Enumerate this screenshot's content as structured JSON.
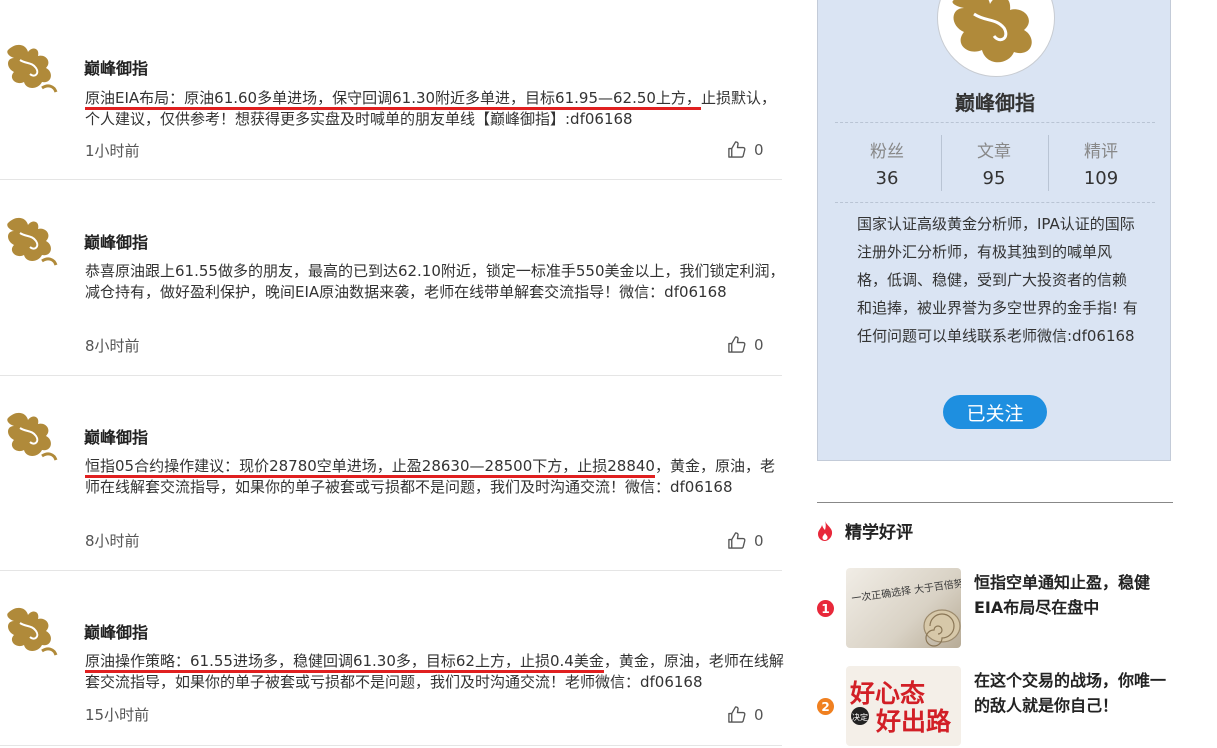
{
  "feed": {
    "posts": [
      {
        "author": "巅峰御指",
        "highlight": "原油EIA布局：原油61.60多单进场，保守回调61.30附近多单进，目标61.95—62.50上方，",
        "text": "止损默认，个人建议，仅供参考！想获得更多实盘及时喊单的朋友单线【巅峰御指】:df06168",
        "time": "1小时前",
        "likes": "0"
      },
      {
        "author": "巅峰御指",
        "highlight": "",
        "text": "恭喜原油跟上61.55做多的朋友，最高的已到达62.10附近，锁定一标准手550美金以上，我们锁定利润，减仓持有，做好盈利保护，晚间EIA原油数据来袭，老师在线带单解套交流指导！微信：df06168",
        "time": "8小时前",
        "likes": "0"
      },
      {
        "author": "巅峰御指",
        "highlight": "恒指05合约操作建议：现价28780空单进场，止盈28630—28500下方，止损28840",
        "text": "，黄金，原油，老师在线解套交流指导，如果你的单子被套或亏损都不是问题，我们及时沟通交流！微信：df06168",
        "time": "8小时前",
        "likes": "0"
      },
      {
        "author": "巅峰御指",
        "highlight": "原油操作策略：61.55进场多，稳健回调61.30多，目标62上方，止损0.4美金",
        "text": "，黄金，原油，老师在线解套交流指导，如果你的单子被套或亏损都不是问题，我们及时沟通交流！老师微信：df06168",
        "time": "15小时前",
        "likes": "0"
      }
    ]
  },
  "profile": {
    "name": "巅峰御指",
    "stats": [
      {
        "label": "粉丝",
        "value": "36"
      },
      {
        "label": "文章",
        "value": "95"
      },
      {
        "label": "精评",
        "value": "109"
      }
    ],
    "bio": "国家认证高级黄金分析师，IPA认证的国际注册外汇分析师，有极其独到的喊单风格，低调、稳健，受到广大投资者的信赖和追捧，被业界誉为多空世界的金手指! 有任何问题可以单线联系老师微信:df06168",
    "follow_label": "已关注"
  },
  "recommend": {
    "title": "精学好评",
    "items": [
      {
        "rank": "1",
        "title": "恒指空单通知止盈，稳健EIA布局尽在盘中",
        "thumb_text": "一次正确选择 大于百倍努力"
      },
      {
        "rank": "2",
        "title": "在这个交易的战场，你唯一的敌人就是你自己！",
        "thumb_text_1": "好心态",
        "thumb_badge": "决定",
        "thumb_text_2": "好出路"
      }
    ]
  },
  "colors": {
    "accent_blue": "#1e8fe0",
    "highlight_red": "#e02020",
    "card_bg": "#dae4f3",
    "rank_1": "#e8283a",
    "rank_2": "#f08020",
    "fire_icon": "#e8283a"
  }
}
